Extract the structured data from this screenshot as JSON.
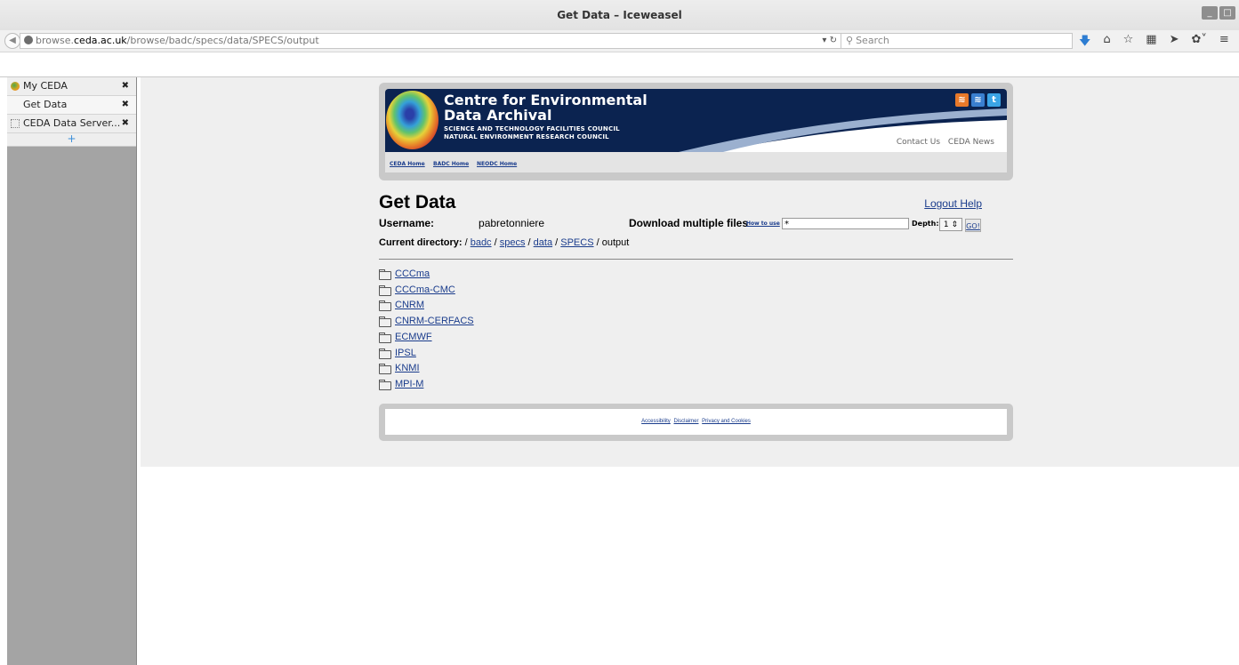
{
  "window": {
    "title": "Get Data – Iceweasel",
    "controls": [
      "_",
      "□"
    ]
  },
  "navbar": {
    "url_prefix": "browse.",
    "url_domain": "ceda.ac.uk",
    "url_path": "/browse/badc/specs/data/SPECS/output",
    "search_placeholder": "Search",
    "icons": [
      "download-icon",
      "home-icon",
      "bookmark-star-icon",
      "reader-icon",
      "send-icon",
      "extensions-icon",
      "menu-icon"
    ]
  },
  "sidebar": {
    "tabs": [
      {
        "label": "My CEDA",
        "icon": "ceda-logo-icon"
      },
      {
        "label": "Get Data"
      },
      {
        "label": "CEDA Data Server..."
      }
    ],
    "new_tab": "+"
  },
  "header": {
    "title_line1": "Centre for Environmental",
    "title_line2": "Data Archival",
    "sub_line1": "SCIENCE AND TECHNOLOGY FACILITIES COUNCIL",
    "sub_line2": "NATURAL ENVIRONMENT RESEARCH COUNCIL",
    "contact": "Contact Us",
    "news": "CEDA News",
    "nav": [
      "CEDA Home",
      "BADC Home",
      "NEODC Home"
    ]
  },
  "main": {
    "heading": "Get Data",
    "logout": "Logout",
    "help": "Help",
    "username_label": "Username:",
    "username": "pabretonniere",
    "download_label": "Download multiple files",
    "how_to_use": "How to use",
    "pattern_value": "*",
    "depth_label": "Depth:",
    "depth_value": "1",
    "go_label": "GO!",
    "current_dir_label": "Current directory:",
    "path": [
      "badc",
      "specs",
      "data",
      "SPECS"
    ],
    "path_current": "output",
    "folders": [
      "CCCma",
      "CCCma-CMC",
      "CNRM",
      "CNRM-CERFACS",
      "ECMWF",
      "IPSL",
      "KNMI",
      "MPI-M"
    ]
  },
  "footer": {
    "links": [
      "Accessibility",
      "Disclaimer",
      "Privacy and Cookies"
    ]
  }
}
